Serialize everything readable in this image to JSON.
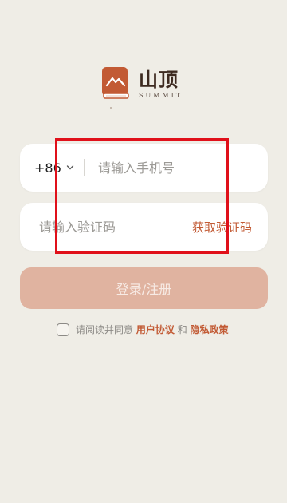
{
  "brand": {
    "title": "山顶",
    "subtitle": "SUMMIT",
    "accent_color": "#c25a34"
  },
  "phone": {
    "country_code": "+86",
    "placeholder": "请输入手机号"
  },
  "code": {
    "placeholder": "请输入验证码",
    "get_code_label": "获取验证码"
  },
  "login": {
    "label": "登录/注册",
    "button_color": "#e0b3a0"
  },
  "agreement": {
    "checked": false,
    "prefix": "请阅读并同意",
    "user_agreement": "用户协议",
    "and": "和",
    "privacy_policy": "隐私政策"
  },
  "highlight_box": {
    "color": "#e0101a"
  }
}
